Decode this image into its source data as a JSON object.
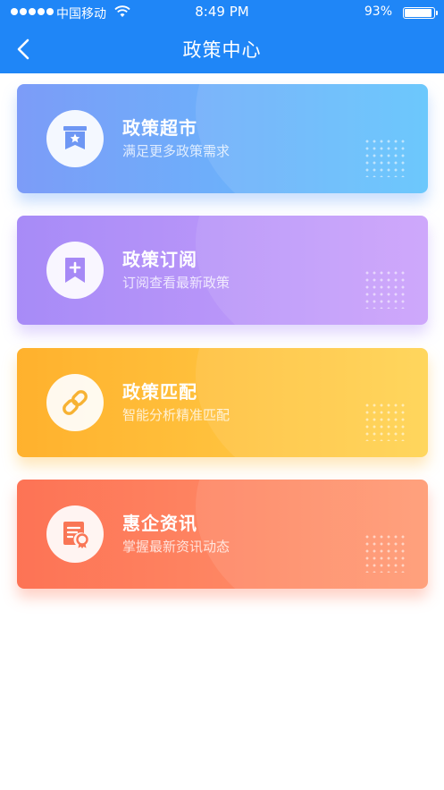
{
  "status_bar": {
    "carrier": "中国移动",
    "time": "8:49 PM",
    "battery": "93%",
    "battery_level": 0.93
  },
  "nav": {
    "title": "政策中心",
    "back_icon": "chevron-left-icon"
  },
  "cards": [
    {
      "title": "政策超市",
      "subtitle": "满足更多政策需求",
      "icon": "store-flag-icon",
      "color": "#7c9cf8"
    },
    {
      "title": "政策订阅",
      "subtitle": "订阅查看最新政策",
      "icon": "bookmark-plus-icon",
      "color": "#a78bf7"
    },
    {
      "title": "政策匹配",
      "subtitle": "智能分析精准匹配",
      "icon": "link-icon",
      "color": "#ffb12d"
    },
    {
      "title": "惠企资讯",
      "subtitle": "掌握最新资讯动态",
      "icon": "certificate-doc-icon",
      "color": "#fd7355"
    }
  ],
  "colors": {
    "header": "#1f86f7"
  }
}
